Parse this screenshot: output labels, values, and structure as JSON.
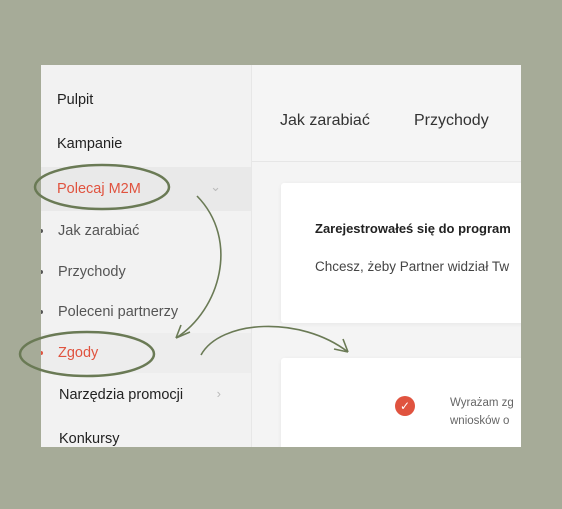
{
  "sidebar": {
    "items": [
      {
        "label": "Pulpit"
      },
      {
        "label": "Kampanie"
      },
      {
        "label": "Polecaj M2M",
        "chevron": "⌄"
      },
      {
        "label": "Jak zarabiać"
      },
      {
        "label": "Przychody"
      },
      {
        "label": "Poleceni partnerzy"
      },
      {
        "label": "Zgody"
      },
      {
        "label": "Narzędzia promocji",
        "chevron": "›"
      },
      {
        "label": "Konkursy"
      }
    ]
  },
  "tabs": [
    {
      "label": "Jak zarabiać"
    },
    {
      "label": "Przychody"
    }
  ],
  "card1": {
    "title": "Zarejestrowałeś się do program",
    "text": "Chcesz, żeby Partner widział Tw"
  },
  "card2": {
    "consent_line1": "Wyrażam zg",
    "consent_line2": "wniosków o",
    "check_icon": "check-icon"
  },
  "colors": {
    "accent": "#e0533f",
    "annotation": "#6a7a55",
    "backdrop": "#a6ab98"
  }
}
